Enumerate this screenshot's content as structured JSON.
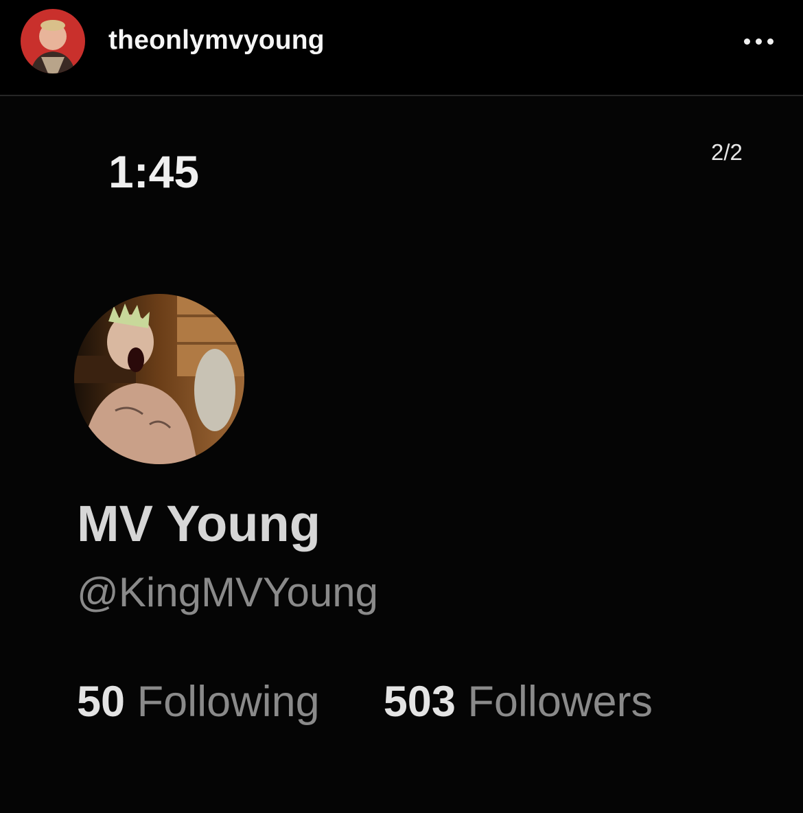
{
  "header": {
    "username": "theonlymvyoung",
    "avatar_icon": "profile-photo",
    "more_icon": "more-options-icon"
  },
  "post": {
    "counter": "2/2",
    "screenshot": {
      "clock": "1:45",
      "display_name": "MV Young",
      "handle": "@KingMVYoung",
      "following_count": "50",
      "following_label": "Following",
      "followers_count": "503",
      "followers_label": "Followers"
    }
  },
  "colors": {
    "background": "#000000",
    "divider": "#262626",
    "avatar_ring": "#c9302c",
    "muted_text": "#8a8a8a"
  }
}
